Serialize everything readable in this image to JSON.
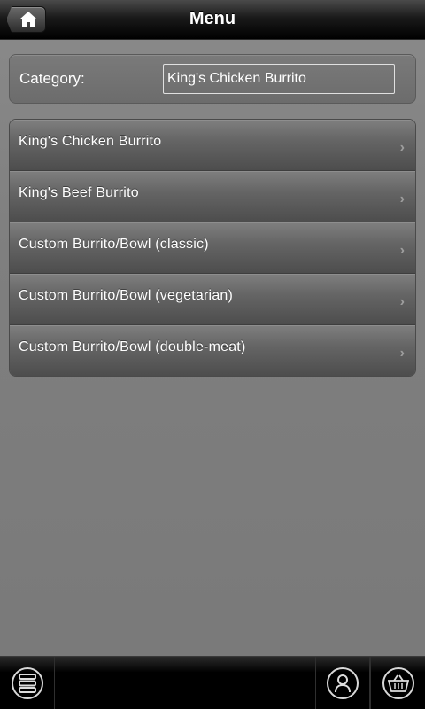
{
  "header": {
    "title": "Menu",
    "home_icon": "home-icon"
  },
  "category": {
    "label": "Category:",
    "value": "King's Chicken Burrito"
  },
  "items": [
    {
      "label": "King's Chicken Burrito"
    },
    {
      "label": "King's Beef Burrito"
    },
    {
      "label": "Custom Burrito/Bowl (classic)"
    },
    {
      "label": "Custom Burrito/Bowl (vegetarian)"
    },
    {
      "label": "Custom Burrito/Bowl (double-meat)"
    }
  ],
  "toolbar": {
    "left_icon": "server-list-icon",
    "right_icons": [
      "user-icon",
      "basket-icon"
    ]
  },
  "colors": {
    "background": "#7f7f7f",
    "header": "#000000",
    "text": "#ffffff"
  }
}
